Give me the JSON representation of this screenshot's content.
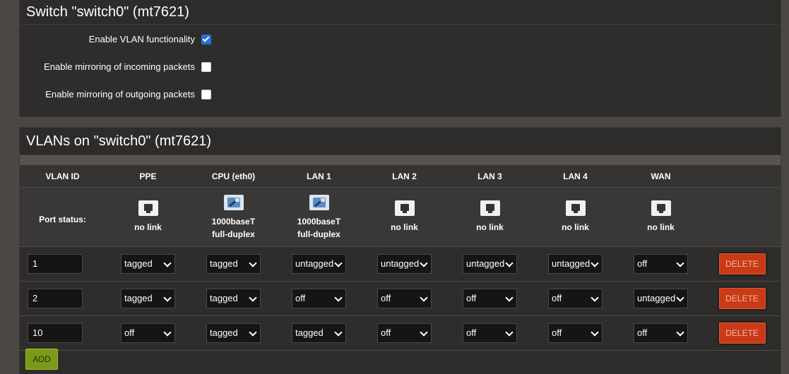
{
  "switch_panel": {
    "title": "Switch \"switch0\" (mt7621)",
    "options": [
      {
        "label": "Enable VLAN functionality",
        "checked": true
      },
      {
        "label": "Enable mirroring of incoming packets",
        "checked": false
      },
      {
        "label": "Enable mirroring of outgoing packets",
        "checked": false
      }
    ]
  },
  "vlan_panel": {
    "title": "VLANs on \"switch0\" (mt7621)",
    "headers": [
      "VLAN ID",
      "PPE",
      "CPU (eth0)",
      "LAN 1",
      "LAN 2",
      "LAN 3",
      "LAN 4",
      "WAN"
    ],
    "port_status_label": "Port status:",
    "port_status": [
      {
        "icon": "port-disconnected-icon",
        "line1": "no link",
        "line2": ""
      },
      {
        "icon": "port-connected-icon",
        "line1": "1000baseT",
        "line2": "full-duplex"
      },
      {
        "icon": "port-connected-icon",
        "line1": "1000baseT",
        "line2": "full-duplex"
      },
      {
        "icon": "port-disconnected-icon",
        "line1": "no link",
        "line2": ""
      },
      {
        "icon": "port-disconnected-icon",
        "line1": "no link",
        "line2": ""
      },
      {
        "icon": "port-disconnected-icon",
        "line1": "no link",
        "line2": ""
      },
      {
        "icon": "port-disconnected-icon",
        "line1": "no link",
        "line2": ""
      }
    ],
    "rows": [
      {
        "vlan_id": "1",
        "ports": [
          "tagged",
          "tagged",
          "untagged",
          "untagged",
          "untagged",
          "untagged",
          "off"
        ]
      },
      {
        "vlan_id": "2",
        "ports": [
          "tagged",
          "tagged",
          "off",
          "off",
          "off",
          "off",
          "untagged"
        ]
      },
      {
        "vlan_id": "10",
        "ports": [
          "off",
          "tagged",
          "tagged",
          "off",
          "off",
          "off",
          "off"
        ]
      }
    ],
    "delete_label": "DELETE",
    "add_label": "ADD"
  },
  "colors": {
    "background": "#4a4744",
    "panel": "#2f2d2b",
    "delete_button": "#c93a17",
    "add_button": "#7a9a1a",
    "checkbox_checked": "#2a6fd6"
  }
}
